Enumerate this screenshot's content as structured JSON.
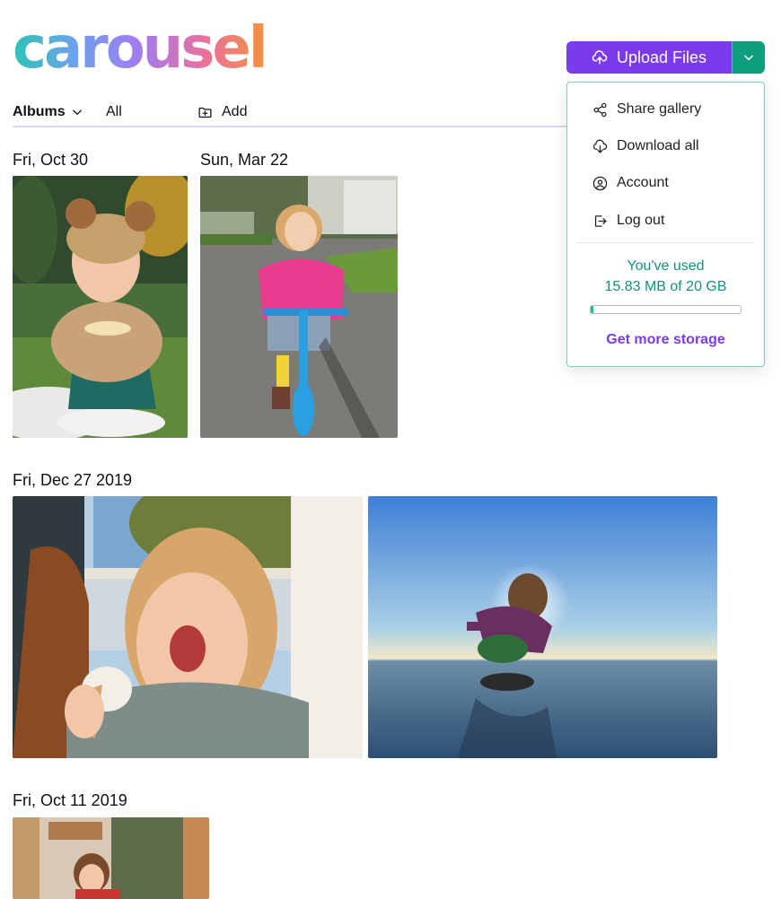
{
  "app": {
    "logo": "carousel"
  },
  "header": {
    "upload_label": "Upload Files",
    "upload_icon": "upload-cloud-icon",
    "caret_icon": "chevron-down-icon"
  },
  "toolbar": {
    "albums_label": "Albums",
    "all_label": "All",
    "add_label": "Add",
    "add_icon": "folder-plus-icon"
  },
  "dropdown": {
    "items": [
      {
        "label": "Share gallery",
        "icon": "share-icon"
      },
      {
        "label": "Download all",
        "icon": "download-cloud-icon"
      },
      {
        "label": "Account",
        "icon": "user-circle-icon"
      },
      {
        "label": "Log out",
        "icon": "logout-icon"
      }
    ],
    "usage_line1": "You've used",
    "usage_line2": "15.83 MB of 20 GB",
    "usage_fraction": 0.02,
    "more_storage": "Get more storage"
  },
  "groups": [
    {
      "date": "Fri, Oct 30"
    },
    {
      "date": "Sun, Mar 22"
    },
    {
      "date": "Fri, Dec 27 2019"
    },
    {
      "date": "Fri, Oct 11 2019"
    }
  ],
  "colors": {
    "accent": "#7c3aed",
    "teal": "#0f9e7c",
    "usage_text": "#139377",
    "progress": "#19c394"
  }
}
